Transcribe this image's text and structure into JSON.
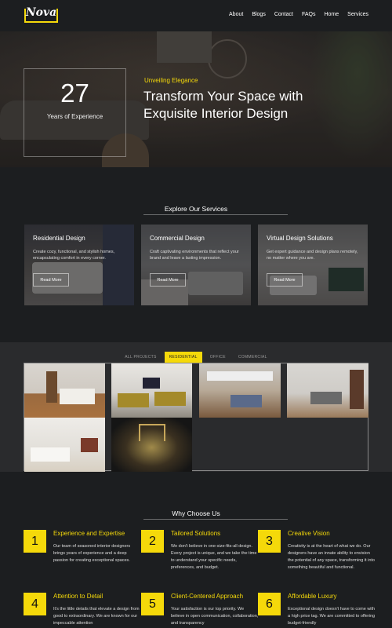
{
  "brand": {
    "logo": "Nova"
  },
  "nav": {
    "items": [
      "About",
      "Blogs",
      "Contact",
      "FAQs",
      "Home",
      "Services"
    ]
  },
  "hero": {
    "years": "27",
    "years_label": "Years of Experience",
    "kicker": "Unveiling Elegance",
    "title": "Transform Your Space with Exquisite Interior Design"
  },
  "services": {
    "heading": "Explore Our Services",
    "cards": [
      {
        "title": "Residential Design",
        "desc": "Create cozy, functional, and stylish homes, encapsulating comfort in every corner.",
        "button": "Read More"
      },
      {
        "title": "Commercial Design",
        "desc": "Craft captivating environments that reflect your brand and leave a lasting impression.",
        "button": "Read More"
      },
      {
        "title": "Virtual Design Solutions",
        "desc": "Get expert guidance and design plans remotely, no matter where you are.",
        "button": "Read More"
      }
    ]
  },
  "portfolio": {
    "tabs": [
      "ALL PROJECTS",
      "RESIDENTIAL",
      "OFFICE",
      "COMMERCIAL"
    ],
    "active_tab": "RESIDENTIAL"
  },
  "why": {
    "heading": "Why Choose Us",
    "features": [
      {
        "num": "1",
        "title": "Experience and Expertise",
        "desc": "Our team of seasoned interior designers brings years of experience and a deep passion for creating exceptional spaces."
      },
      {
        "num": "2",
        "title": "Tailored Solutions",
        "desc": "We don't believe in one-size-fits-all design. Every project is unique, and we take the time to understand your specific needs, preferences, and budget."
      },
      {
        "num": "3",
        "title": "Creative Vision",
        "desc": "Creativity is at the heart of what we do. Our designers have an innate ability to envision the potential of any space, transforming it into something beautiful and functional."
      },
      {
        "num": "4",
        "title": "Attention to Detail",
        "desc": "It's the little details that elevate a design from good to extraordinary. We are known for our impeccable attention"
      },
      {
        "num": "5",
        "title": "Client-Centered Approach",
        "desc": "Your satisfaction is our top priority. We believe in open communication, collaboration, and transparency"
      },
      {
        "num": "6",
        "title": "Affordable Luxury",
        "desc": "Exceptional design doesn't have to come with a high price tag. We are committed to offering budget-friendly"
      }
    ]
  },
  "colors": {
    "accent": "#f5d90a",
    "background": "#1c1e20",
    "portfolio_bg": "#2a2b2d"
  }
}
